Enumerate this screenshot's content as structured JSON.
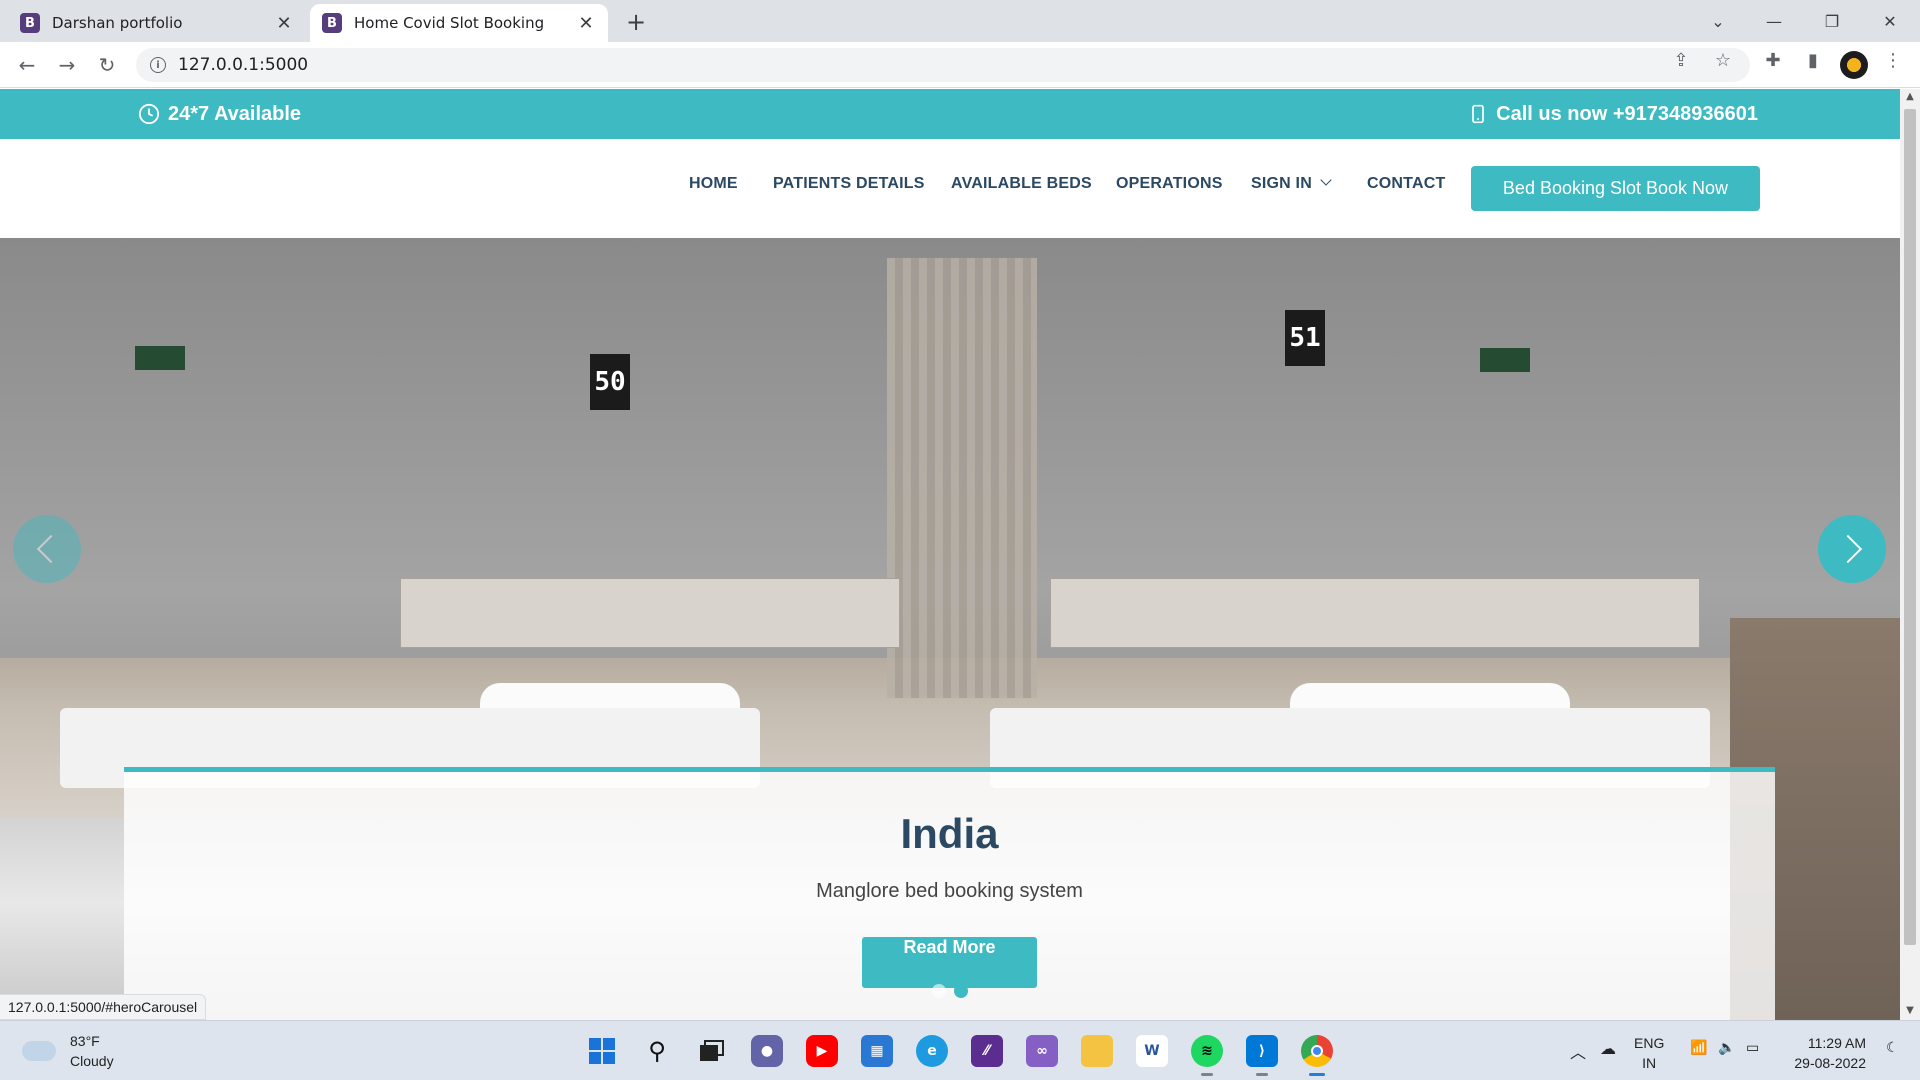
{
  "browser": {
    "tabs": [
      {
        "title": "Darshan portfolio",
        "favicon": "B",
        "active": false
      },
      {
        "title": "Home Covid Slot Booking",
        "favicon": "B",
        "active": true
      }
    ],
    "url": "127.0.0.1:5000",
    "status_url": "127.0.0.1:5000/#heroCarousel",
    "icons": [
      "back-icon",
      "forward-icon",
      "reload-icon",
      "info-icon",
      "share-icon",
      "star-icon",
      "extensions-icon",
      "sidepanel-icon",
      "profile-avatar",
      "menu-icon"
    ]
  },
  "topbar": {
    "availability": "24*7 Available",
    "call": "Call us now +917348936601",
    "accent": "#3dbac2"
  },
  "nav": {
    "items": [
      "HOME",
      "PATIENTS DETAILS",
      "AVAILABLE BEDS",
      "OPERATIONS",
      "SIGN IN",
      "CONTACT"
    ],
    "cta": "Bed Booking Slot Book Now"
  },
  "hero": {
    "room_numbers": [
      "50",
      "51"
    ],
    "caption": {
      "title": "India",
      "subtitle": "Manglore bed booking system",
      "button": "Read More"
    },
    "slide_count": 2,
    "active_slide": 2
  },
  "taskbar": {
    "weather": {
      "temp": "83°F",
      "condition": "Cloudy"
    },
    "apps": [
      "start",
      "search",
      "task-view",
      "teams-chat",
      "youtube",
      "microsoft-store",
      "edge",
      "visual-studio-preview",
      "visual-studio",
      "file-explorer",
      "word",
      "spotify",
      "vscode",
      "chrome"
    ],
    "language": {
      "line1": "ENG",
      "line2": "IN"
    },
    "time": "11:29 AM",
    "date": "29-08-2022"
  }
}
